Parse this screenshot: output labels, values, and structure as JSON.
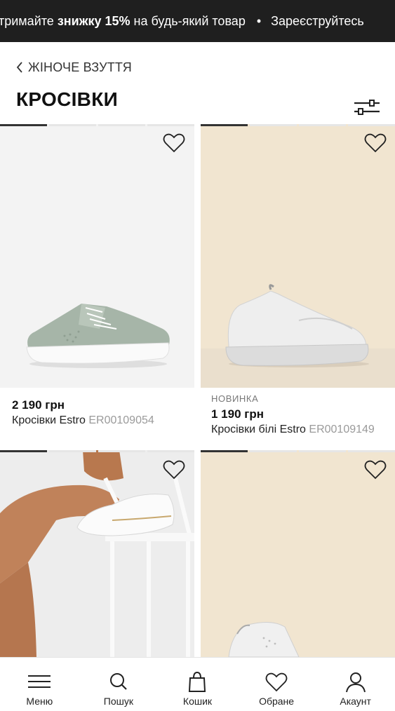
{
  "promo": {
    "part1": "тримайте ",
    "part2": "знижку 15%",
    "part3": " на будь-який товар",
    "dot": "•",
    "part4": "Зареєструйтесь"
  },
  "breadcrumb": {
    "label": "ЖІНОЧЕ ВЗУТТЯ"
  },
  "page": {
    "title": "КРОСІВКИ"
  },
  "products": [
    {
      "badge": "",
      "price": "2 190 грн",
      "name": "Кросівки Estro",
      "code": "ER00109054"
    },
    {
      "badge": "НОВИНКА",
      "price": "1 190 грн",
      "name": "Кросівки білі Estro",
      "code": "ER00109149"
    }
  ],
  "tabbar": {
    "menu": "Меню",
    "search": "Пошук",
    "cart": "Кошик",
    "favorites": "Обране",
    "account": "Акаунт"
  },
  "colors": {
    "promo_bg": "#1f1f1f",
    "beige": "#f1e5d0",
    "grey_bg": "#f2f2f2"
  }
}
